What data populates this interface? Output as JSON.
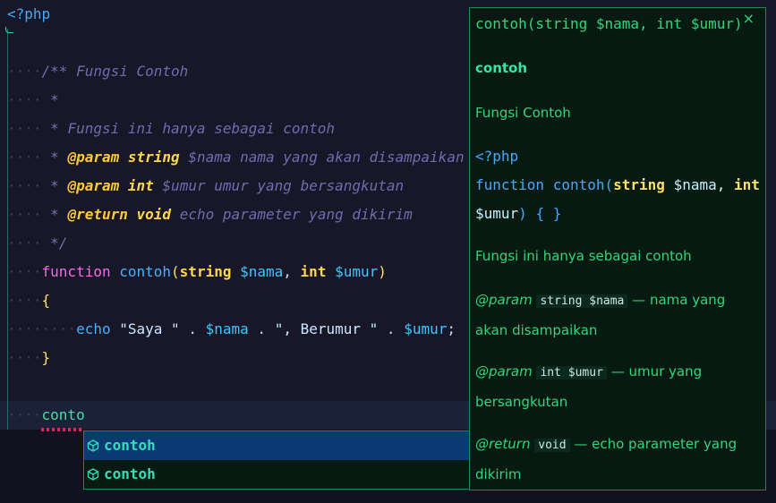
{
  "editor": {
    "lines": {
      "php_open": "<?php",
      "doc_open": "/** Fungsi Contoh",
      "star": "*",
      "doc_desc": "* Fungsi ini hanya sebagai contoh",
      "param1_tag": "@param",
      "param1_type": "string",
      "param1_var": "$nama",
      "param1_desc": "nama yang akan disampaikan",
      "param2_tag": "@param",
      "param2_type": "int",
      "param2_var": "$umur",
      "param2_desc": "umur yang bersangkutan",
      "return_tag": "@return",
      "return_type": "void",
      "return_desc": "echo parameter yang dikirim",
      "doc_close": "*/",
      "fn_keyword": "function",
      "fn_name": "contoh",
      "fn_params_type1": "string",
      "fn_params_var1": "$nama",
      "fn_params_type2": "int",
      "fn_params_var2": "$umur",
      "brace_open": "{",
      "echo_kw": "echo",
      "str1": "\"Saya \"",
      "echo_var1": "$nama",
      "str2": "\", Berumur \"",
      "echo_var2": "$umur",
      "brace_close": "}",
      "typed": "conto"
    }
  },
  "suggest": {
    "items": [
      {
        "label": "contoh",
        "icon": "cube-icon",
        "selected": true
      },
      {
        "label": "contoh",
        "icon": "cube-icon",
        "selected": false
      }
    ]
  },
  "doc": {
    "signature": "contoh(string $nama, int $umur)",
    "close": "×",
    "name": "contoh",
    "summary": "Fungsi Contoh",
    "code_php": "<?php",
    "code_function": "function",
    "code_name": "contoh(",
    "code_type1": "string",
    "code_var1": "$nama",
    "code_type2": "int",
    "code_var2": "$umur",
    "code_tail": ") { }",
    "description": "Fungsi ini hanya sebagai contoh",
    "params": [
      {
        "tag": "@param",
        "code": "string $nama",
        "desc": "— nama yang akan disampaikan"
      },
      {
        "tag": "@param",
        "code": "int $umur",
        "desc": "— umur yang bersangkutan"
      },
      {
        "tag": "@return",
        "code": "void",
        "desc": "— echo parameter yang dikirim"
      }
    ]
  },
  "colors": {
    "background": "#181728",
    "accent": "#2fd67a",
    "selection": "#0b3a73"
  }
}
